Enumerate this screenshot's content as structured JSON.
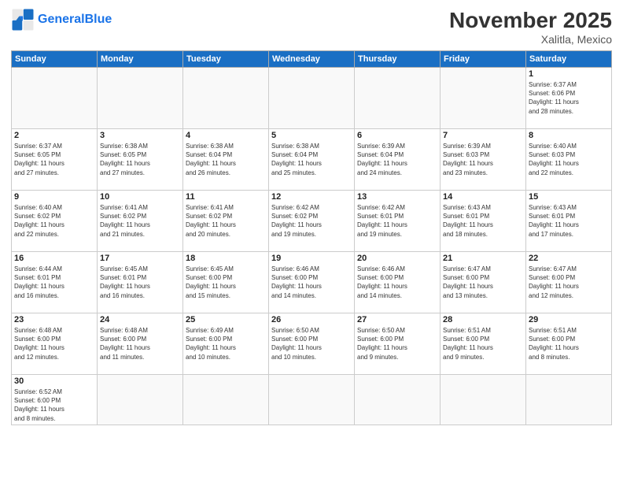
{
  "header": {
    "logo_general": "General",
    "logo_blue": "Blue",
    "title": "November 2025",
    "subtitle": "Xalitla, Mexico"
  },
  "weekdays": [
    "Sunday",
    "Monday",
    "Tuesday",
    "Wednesday",
    "Thursday",
    "Friday",
    "Saturday"
  ],
  "weeks": [
    [
      {
        "day": "",
        "info": ""
      },
      {
        "day": "",
        "info": ""
      },
      {
        "day": "",
        "info": ""
      },
      {
        "day": "",
        "info": ""
      },
      {
        "day": "",
        "info": ""
      },
      {
        "day": "",
        "info": ""
      },
      {
        "day": "1",
        "info": "Sunrise: 6:37 AM\nSunset: 6:06 PM\nDaylight: 11 hours\nand 28 minutes."
      }
    ],
    [
      {
        "day": "2",
        "info": "Sunrise: 6:37 AM\nSunset: 6:05 PM\nDaylight: 11 hours\nand 27 minutes."
      },
      {
        "day": "3",
        "info": "Sunrise: 6:38 AM\nSunset: 6:05 PM\nDaylight: 11 hours\nand 27 minutes."
      },
      {
        "day": "4",
        "info": "Sunrise: 6:38 AM\nSunset: 6:04 PM\nDaylight: 11 hours\nand 26 minutes."
      },
      {
        "day": "5",
        "info": "Sunrise: 6:38 AM\nSunset: 6:04 PM\nDaylight: 11 hours\nand 25 minutes."
      },
      {
        "day": "6",
        "info": "Sunrise: 6:39 AM\nSunset: 6:04 PM\nDaylight: 11 hours\nand 24 minutes."
      },
      {
        "day": "7",
        "info": "Sunrise: 6:39 AM\nSunset: 6:03 PM\nDaylight: 11 hours\nand 23 minutes."
      },
      {
        "day": "8",
        "info": "Sunrise: 6:40 AM\nSunset: 6:03 PM\nDaylight: 11 hours\nand 22 minutes."
      }
    ],
    [
      {
        "day": "9",
        "info": "Sunrise: 6:40 AM\nSunset: 6:02 PM\nDaylight: 11 hours\nand 22 minutes."
      },
      {
        "day": "10",
        "info": "Sunrise: 6:41 AM\nSunset: 6:02 PM\nDaylight: 11 hours\nand 21 minutes."
      },
      {
        "day": "11",
        "info": "Sunrise: 6:41 AM\nSunset: 6:02 PM\nDaylight: 11 hours\nand 20 minutes."
      },
      {
        "day": "12",
        "info": "Sunrise: 6:42 AM\nSunset: 6:02 PM\nDaylight: 11 hours\nand 19 minutes."
      },
      {
        "day": "13",
        "info": "Sunrise: 6:42 AM\nSunset: 6:01 PM\nDaylight: 11 hours\nand 19 minutes."
      },
      {
        "day": "14",
        "info": "Sunrise: 6:43 AM\nSunset: 6:01 PM\nDaylight: 11 hours\nand 18 minutes."
      },
      {
        "day": "15",
        "info": "Sunrise: 6:43 AM\nSunset: 6:01 PM\nDaylight: 11 hours\nand 17 minutes."
      }
    ],
    [
      {
        "day": "16",
        "info": "Sunrise: 6:44 AM\nSunset: 6:01 PM\nDaylight: 11 hours\nand 16 minutes."
      },
      {
        "day": "17",
        "info": "Sunrise: 6:45 AM\nSunset: 6:01 PM\nDaylight: 11 hours\nand 16 minutes."
      },
      {
        "day": "18",
        "info": "Sunrise: 6:45 AM\nSunset: 6:00 PM\nDaylight: 11 hours\nand 15 minutes."
      },
      {
        "day": "19",
        "info": "Sunrise: 6:46 AM\nSunset: 6:00 PM\nDaylight: 11 hours\nand 14 minutes."
      },
      {
        "day": "20",
        "info": "Sunrise: 6:46 AM\nSunset: 6:00 PM\nDaylight: 11 hours\nand 14 minutes."
      },
      {
        "day": "21",
        "info": "Sunrise: 6:47 AM\nSunset: 6:00 PM\nDaylight: 11 hours\nand 13 minutes."
      },
      {
        "day": "22",
        "info": "Sunrise: 6:47 AM\nSunset: 6:00 PM\nDaylight: 11 hours\nand 12 minutes."
      }
    ],
    [
      {
        "day": "23",
        "info": "Sunrise: 6:48 AM\nSunset: 6:00 PM\nDaylight: 11 hours\nand 12 minutes."
      },
      {
        "day": "24",
        "info": "Sunrise: 6:48 AM\nSunset: 6:00 PM\nDaylight: 11 hours\nand 11 minutes."
      },
      {
        "day": "25",
        "info": "Sunrise: 6:49 AM\nSunset: 6:00 PM\nDaylight: 11 hours\nand 10 minutes."
      },
      {
        "day": "26",
        "info": "Sunrise: 6:50 AM\nSunset: 6:00 PM\nDaylight: 11 hours\nand 10 minutes."
      },
      {
        "day": "27",
        "info": "Sunrise: 6:50 AM\nSunset: 6:00 PM\nDaylight: 11 hours\nand 9 minutes."
      },
      {
        "day": "28",
        "info": "Sunrise: 6:51 AM\nSunset: 6:00 PM\nDaylight: 11 hours\nand 9 minutes."
      },
      {
        "day": "29",
        "info": "Sunrise: 6:51 AM\nSunset: 6:00 PM\nDaylight: 11 hours\nand 8 minutes."
      }
    ],
    [
      {
        "day": "30",
        "info": "Sunrise: 6:52 AM\nSunset: 6:00 PM\nDaylight: 11 hours\nand 8 minutes."
      },
      {
        "day": "",
        "info": ""
      },
      {
        "day": "",
        "info": ""
      },
      {
        "day": "",
        "info": ""
      },
      {
        "day": "",
        "info": ""
      },
      {
        "day": "",
        "info": ""
      },
      {
        "day": "",
        "info": ""
      }
    ]
  ]
}
